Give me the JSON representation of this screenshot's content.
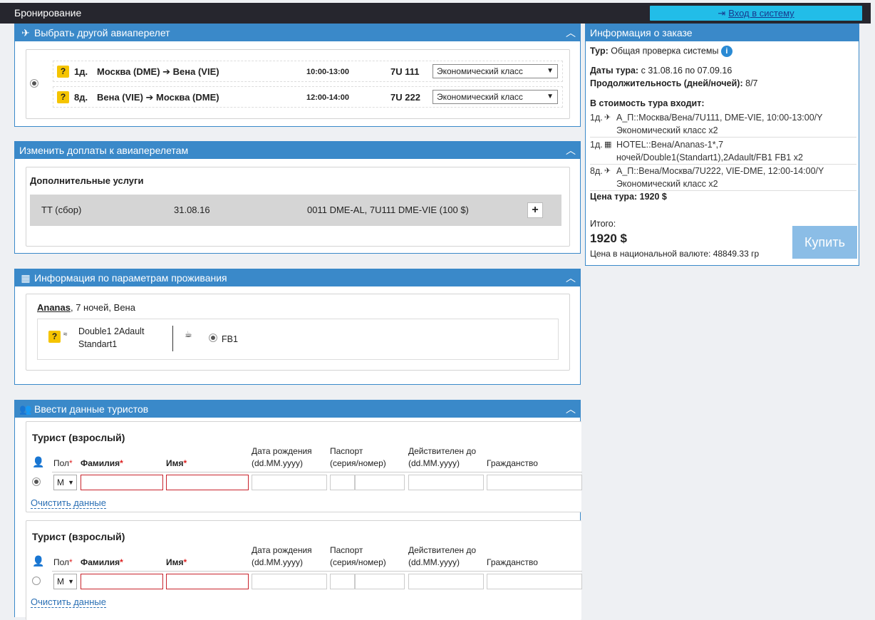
{
  "header": {
    "title": "Бронирование",
    "login_label": "Вход в систему"
  },
  "flights_panel": {
    "title": "Выбрать другой авиаперелет",
    "rows": [
      {
        "day": "1д.",
        "route": "Москва (DME) ➔ Вена (VIE)",
        "time": "10:00-13:00",
        "flight": "7U 111",
        "class": "Экономический класс"
      },
      {
        "day": "8д.",
        "route": "Вена (VIE) ➔ Москва (DME)",
        "time": "12:00-14:00",
        "flight": "7U 222",
        "class": "Экономический класс"
      }
    ]
  },
  "extras_panel": {
    "title": "Изменить доплаты к авиаперелетам",
    "subtitle": "Дополнительные услуги",
    "row": {
      "name": "TT (сбор)",
      "date": "31.08.16",
      "desc": "0011 DME-AL, 7U111 DME-VIE (100 $)",
      "add": "+"
    }
  },
  "accommodation_panel": {
    "title": "Информация по параметрам проживания",
    "hotel_name": "Ananas",
    "hotel_rest": ", 7 ночей, Вена",
    "room_line1": "Double1 2Adault",
    "room_line2": "Standart1",
    "meal": "FB1"
  },
  "tourists_panel": {
    "title": "Ввести данные туристов",
    "tourists": [
      {
        "heading": "Турист (взрослый)",
        "gender": "М",
        "clear": "Очистить данные"
      },
      {
        "heading": "Турист (взрослый)",
        "gender": "М",
        "clear": "Очистить данные"
      }
    ],
    "headers": {
      "gender": "Пол",
      "surname": "Фамилия",
      "name": "Имя",
      "birth1": "Дата рождения",
      "birth2": "(dd.MM.yyyy)",
      "passport1": "Паспорт",
      "passport2": "(серия/номер)",
      "valid1": "Действителен до",
      "valid2": "(dd.MM.yyyy)",
      "citizenship": "Гражданство",
      "required_mark": "*"
    }
  },
  "order_panel": {
    "title": "Информация о заказе",
    "tour_label": "Тур:",
    "tour_value": "Общая проверка системы",
    "dates_label": "Даты тура:",
    "dates_value": "с 31.08.16 по 07.09.16",
    "duration_label": "Продолжительность (дней/ночей):",
    "duration_value": "8/7",
    "included_label": "В стоимость тура входит:",
    "items": [
      {
        "day": "1д.",
        "icon": "✈",
        "text": "А_П::Москва/Вена/7U111, DME-VIE, 10:00-13:00/Y Экономический класс x2"
      },
      {
        "day": "1д.",
        "icon": "▦",
        "text": "HOTEL::Вена/Ananas-1*,7 ночей/Double1(Standart1),2Adault/FB1 FB1 x2"
      },
      {
        "day": "8д.",
        "icon": "✈",
        "text": "А_П::Вена/Москва/7U222, VIE-DME, 12:00-14:00/Y Экономический класс x2"
      }
    ],
    "price_label": "Цена тура: 1920 $",
    "total_label": "Итого:",
    "total_value": "1920 $",
    "national_currency": "Цена в национальной валюте: 48849.33 гр",
    "buy_label": "Купить"
  }
}
